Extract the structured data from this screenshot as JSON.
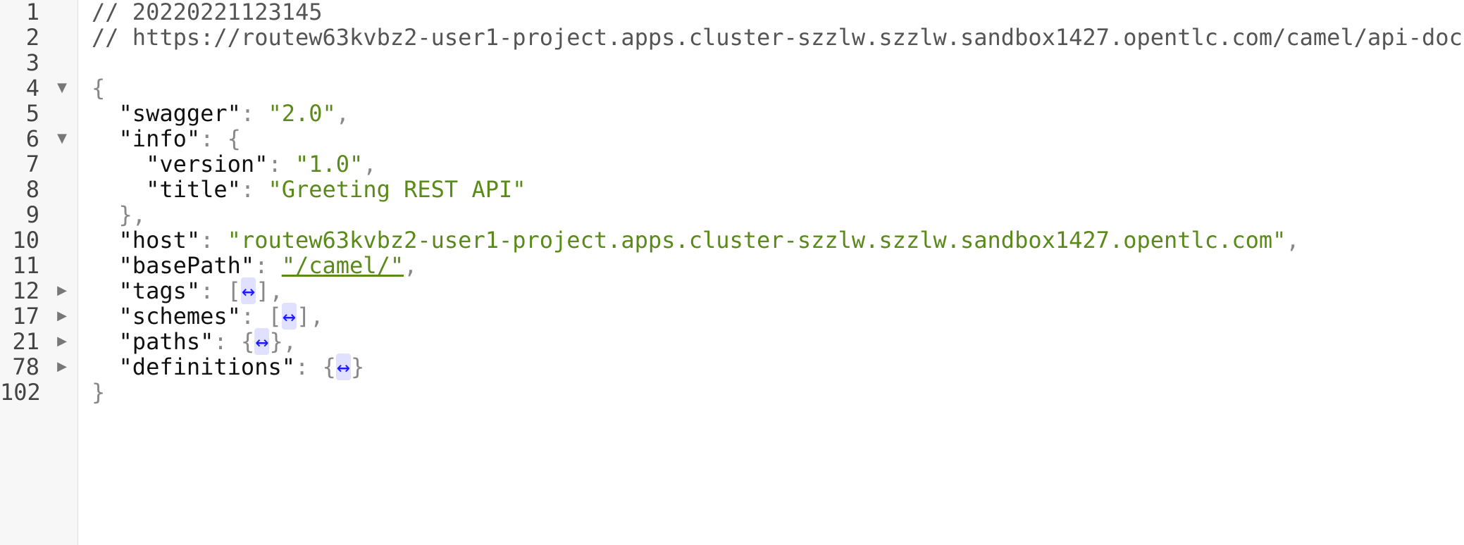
{
  "lines": [
    {
      "num": "1",
      "fold": "",
      "comment": "// 20220221123145"
    },
    {
      "num": "2",
      "fold": "",
      "comment": "// https://routew63kvbz2-user1-project.apps.cluster-szzlw.szzlw.sandbox1427.opentlc.com/camel/api-doc"
    },
    {
      "num": "3",
      "fold": ""
    },
    {
      "num": "4",
      "fold": "▼",
      "open": "{"
    },
    {
      "num": "5",
      "fold": "",
      "key": "\"swagger\"",
      "value": "\"2.0\""
    },
    {
      "num": "6",
      "fold": "▼",
      "key": "\"info\"",
      "open": "{"
    },
    {
      "num": "7",
      "fold": "",
      "key": "\"version\"",
      "value": "\"1.0\""
    },
    {
      "num": "8",
      "fold": "",
      "key": "\"title\"",
      "value": "\"Greeting REST API\""
    },
    {
      "num": "9",
      "fold": "",
      "close": "},"
    },
    {
      "num": "10",
      "fold": "",
      "key": "\"host\"",
      "value": "\"routew63kvbz2-user1-project.apps.cluster-szzlw.szzlw.sandbox1427.opentlc.com\""
    },
    {
      "num": "11",
      "fold": "",
      "key": "\"basePath\"",
      "link_value": "\"/camel/\""
    },
    {
      "num": "12",
      "fold": "▶",
      "key": "\"tags\"",
      "collapsed_open": "[",
      "collapsed_close": "]"
    },
    {
      "num": "17",
      "fold": "▶",
      "key": "\"schemes\"",
      "collapsed_open": "[",
      "collapsed_close": "]"
    },
    {
      "num": "21",
      "fold": "▶",
      "key": "\"paths\"",
      "collapsed_open": "{",
      "collapsed_close": "}"
    },
    {
      "num": "78",
      "fold": "▶",
      "key": "\"definitions\"",
      "collapsed_open": "{",
      "collapsed_close": "}"
    },
    {
      "num": "102",
      "fold": "",
      "close": "}"
    }
  ],
  "symbols": {
    "colon": ": ",
    "comma": ",",
    "expand_glyph": "↔"
  },
  "colors": {
    "string": "#5a8a1a",
    "expand": "#1b1bff",
    "gutter": "#f7f7f7"
  }
}
